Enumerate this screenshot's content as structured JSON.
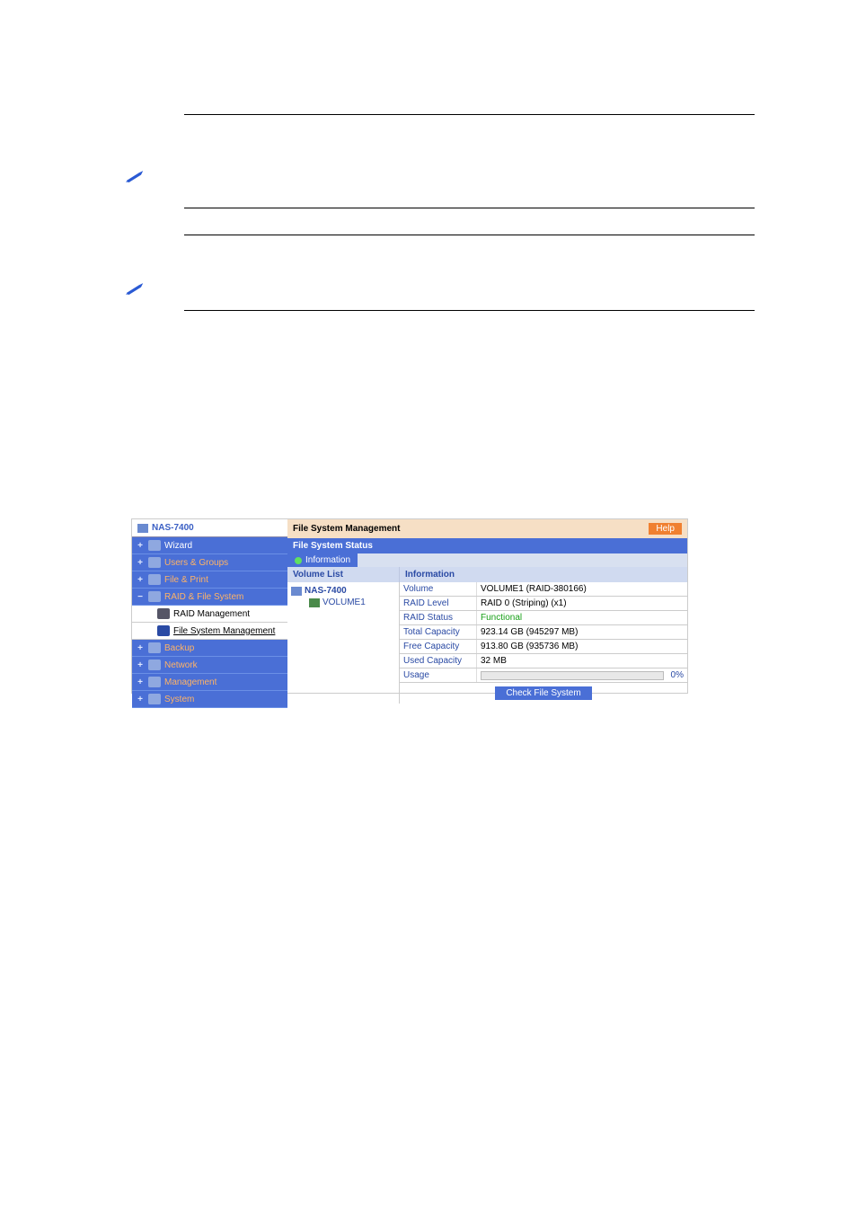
{
  "sidebar": {
    "root": "NAS-7400",
    "items": [
      {
        "label": "Wizard"
      },
      {
        "label": "Users & Groups"
      },
      {
        "label": "File & Print"
      },
      {
        "label": "RAID & File System",
        "children": [
          "RAID Management",
          "File System Management"
        ]
      },
      {
        "label": "Backup"
      },
      {
        "label": "Network"
      },
      {
        "label": "Management"
      },
      {
        "label": "System"
      }
    ]
  },
  "main": {
    "title": "File System Management",
    "help": "Help",
    "status_header": "File System Status",
    "tab": "Information",
    "col_volume_list": "Volume List",
    "col_information": "Information",
    "tree": {
      "root": "NAS-7400",
      "child": "VOLUME1"
    },
    "info": {
      "volume_label": "Volume",
      "volume_value": "VOLUME1 (RAID-380166)",
      "raid_level_label": "RAID Level",
      "raid_level_value": "RAID 0 (Striping) (x1)",
      "raid_status_label": "RAID Status",
      "raid_status_value": "Functional",
      "total_label": "Total Capacity",
      "total_value": "923.14 GB (945297 MB)",
      "free_label": "Free Capacity",
      "free_value": "913.80 GB (935736 MB)",
      "used_label": "Used Capacity",
      "used_value": "32 MB",
      "usage_label": "Usage",
      "usage_pct": "0%"
    },
    "check_button": "Check File System"
  }
}
